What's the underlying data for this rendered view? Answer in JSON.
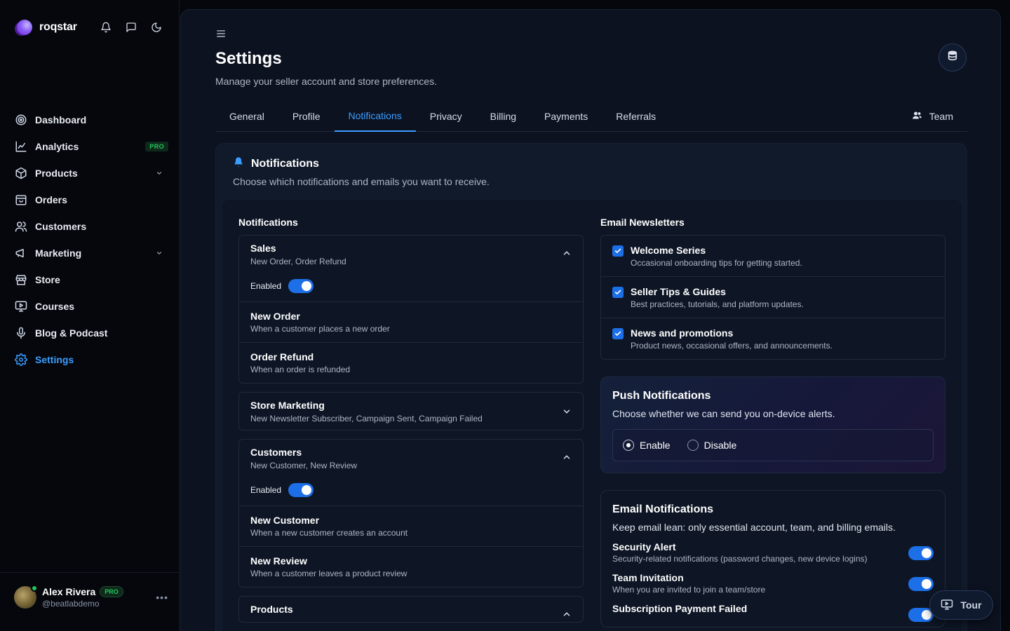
{
  "brand": {
    "name": "roqstar"
  },
  "sidebar": {
    "items": [
      {
        "label": "Dashboard",
        "icon": "dashboard-icon"
      },
      {
        "label": "Analytics",
        "icon": "analytics-icon",
        "badge": "PRO"
      },
      {
        "label": "Products",
        "icon": "box-icon",
        "expandable": true
      },
      {
        "label": "Orders",
        "icon": "orders-icon"
      },
      {
        "label": "Customers",
        "icon": "users-icon"
      },
      {
        "label": "Marketing",
        "icon": "megaphone-icon",
        "expandable": true
      },
      {
        "label": "Store",
        "icon": "store-icon"
      },
      {
        "label": "Courses",
        "icon": "courses-icon"
      },
      {
        "label": "Blog & Podcast",
        "icon": "mic-icon"
      },
      {
        "label": "Settings",
        "icon": "gear-icon",
        "active": true
      }
    ],
    "user": {
      "name": "Alex Rivera",
      "badge": "PRO",
      "handle": "@beatlabdemo"
    }
  },
  "page": {
    "title": "Settings",
    "subtitle": "Manage your seller account and store preferences."
  },
  "tabs": [
    "General",
    "Profile",
    "Notifications",
    "Privacy",
    "Billing",
    "Payments",
    "Referrals"
  ],
  "active_tab": "Notifications",
  "team_tab": "Team",
  "card": {
    "title": "Notifications",
    "subtitle": "Choose which notifications and emails you want to receive."
  },
  "notifications": {
    "label": "Notifications",
    "enabled_label": "Enabled",
    "groups": [
      {
        "title": "Sales",
        "desc": "New Order, Order Refund",
        "expanded": true,
        "enabled": true,
        "rows": [
          {
            "title": "New Order",
            "desc": "When a customer places a new order"
          },
          {
            "title": "Order Refund",
            "desc": "When an order is refunded"
          }
        ]
      },
      {
        "title": "Store Marketing",
        "desc": "New Newsletter Subscriber, Campaign Sent, Campaign Failed",
        "expanded": false
      },
      {
        "title": "Customers",
        "desc": "New Customer, New Review",
        "expanded": true,
        "enabled": true,
        "rows": [
          {
            "title": "New Customer",
            "desc": "When a new customer creates an account"
          },
          {
            "title": "New Review",
            "desc": "When a customer leaves a product review"
          }
        ]
      },
      {
        "title": "Products",
        "expanded": true
      }
    ]
  },
  "newsletters": {
    "label": "Email Newsletters",
    "items": [
      {
        "title": "Welcome Series",
        "desc": "Occasional onboarding tips for getting started.",
        "checked": true
      },
      {
        "title": "Seller Tips & Guides",
        "desc": "Best practices, tutorials, and platform updates.",
        "checked": true
      },
      {
        "title": "News and promotions",
        "desc": "Product news, occasional offers, and announcements.",
        "checked": true
      }
    ]
  },
  "push": {
    "title": "Push Notifications",
    "subtitle": "Choose whether we can send you on-device alerts.",
    "enable_label": "Enable",
    "disable_label": "Disable",
    "selected": "Enable"
  },
  "email_notifications": {
    "title": "Email Notifications",
    "subtitle": "Keep email lean: only essential account, team, and billing emails.",
    "items": [
      {
        "title": "Security Alert",
        "desc": "Security-related notifications (password changes, new device logins)",
        "on": true
      },
      {
        "title": "Team Invitation",
        "desc": "When you are invited to join a team/store",
        "on": true
      },
      {
        "title": "Subscription Payment Failed",
        "on": true
      }
    ]
  },
  "tour": {
    "label": "Tour"
  },
  "colors": {
    "accent": "#3b9eff",
    "toggle": "#1d6fe8",
    "pro_green": "#22c55e"
  }
}
